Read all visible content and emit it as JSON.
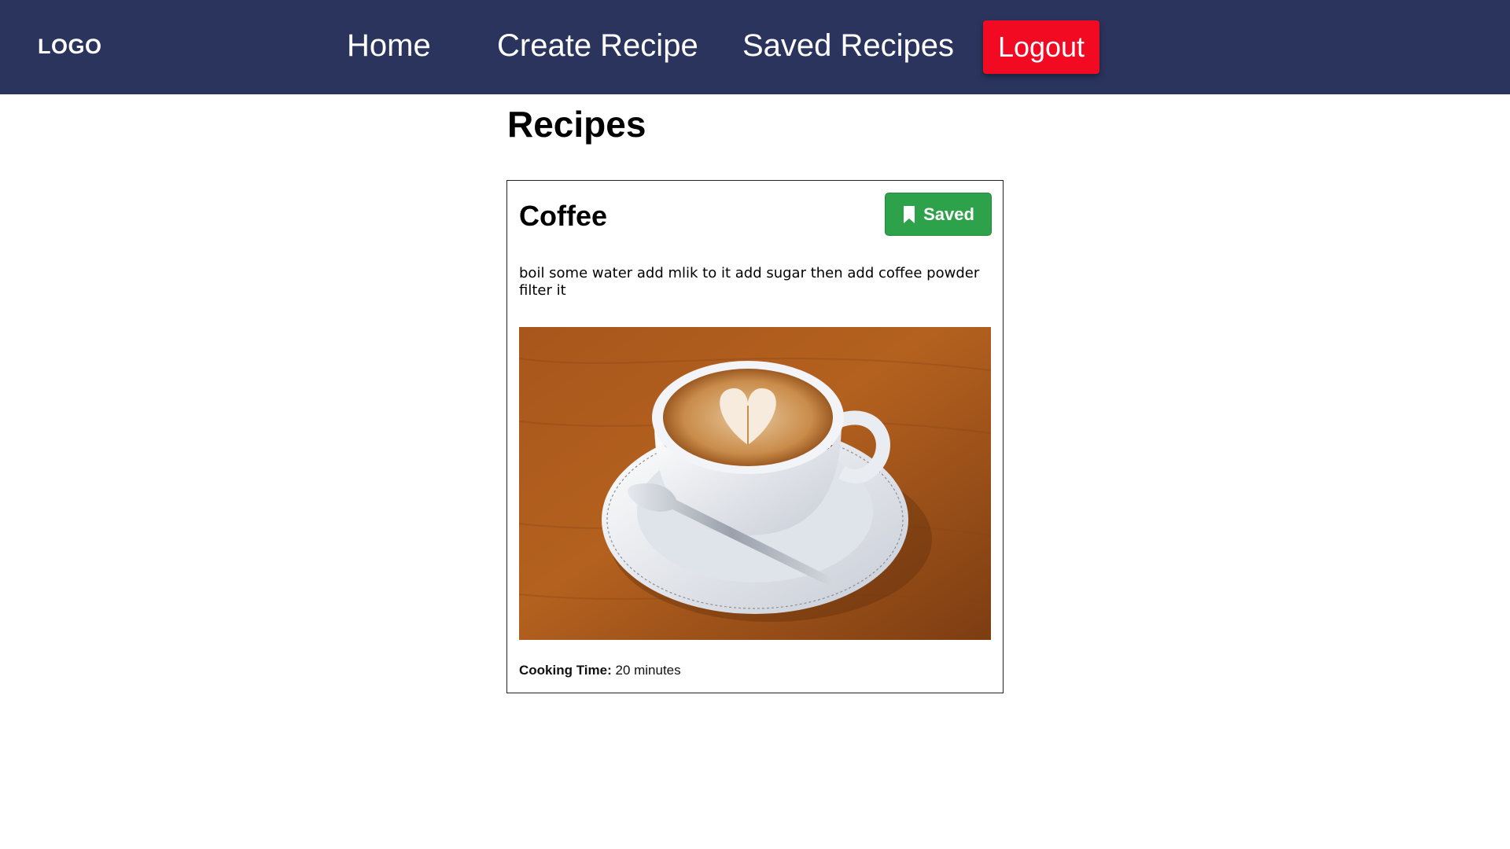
{
  "navbar": {
    "logo": "LOGO",
    "links": [
      {
        "label": "Home"
      },
      {
        "label": "Create Recipe"
      },
      {
        "label": "Saved Recipes"
      }
    ],
    "logout_label": "Logout",
    "colors": {
      "background": "#2b345d",
      "logout": "#f10a22"
    }
  },
  "main": {
    "title": "Recipes",
    "recipes": [
      {
        "name": "Coffee",
        "saved_label": "Saved",
        "saved_icon": "bookmark-icon",
        "saved_color": "#2ea24a",
        "instructions": "boil some water add mlik to it add sugar then add coffee powder filter it",
        "image": "latte-art-coffee-cup-on-saucer-with-spoon",
        "cooking_time_label": "Cooking Time:",
        "cooking_time_value": "20 minutes"
      }
    ]
  }
}
